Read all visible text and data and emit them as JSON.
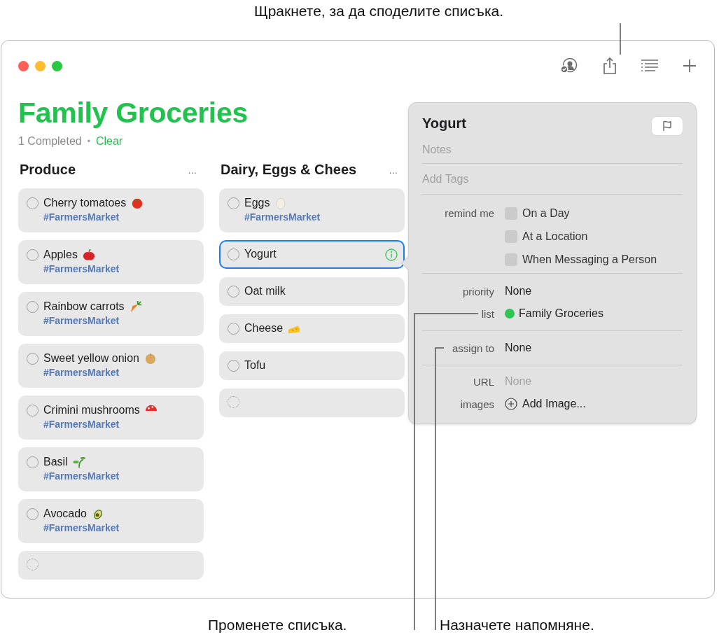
{
  "callout_share": "Щракнете, за да споделите списъка.",
  "callout_list": "Променете списъка.",
  "callout_assign": "Назначете напомняне.",
  "list": {
    "title": "Family Groceries",
    "completed": "1 Completed",
    "separator": "•",
    "clear": "Clear"
  },
  "columns": [
    {
      "title": "Produce",
      "more": "...",
      "items": [
        {
          "kind": "task",
          "name": "Cherry tomatoes",
          "tag": "#FarmersMarket",
          "selected": false
        },
        {
          "kind": "task",
          "name": "Apples",
          "tag": "#FarmersMarket",
          "selected": false
        },
        {
          "kind": "task",
          "name": "Rainbow carrots",
          "tag": "#FarmersMarket",
          "selected": false
        },
        {
          "kind": "task",
          "name": "Sweet yellow onion",
          "tag": "#FarmersMarket",
          "selected": false
        },
        {
          "kind": "task",
          "name": "Crimini mushrooms",
          "tag": "#FarmersMarket",
          "selected": false
        },
        {
          "kind": "task",
          "name": "Basil",
          "tag": "#FarmersMarket",
          "selected": false
        },
        {
          "kind": "task",
          "name": "Avocado",
          "tag": "#FarmersMarket",
          "selected": false
        },
        {
          "kind": "new"
        }
      ]
    },
    {
      "title": "Dairy, Eggs & Chees",
      "more": "...",
      "items": [
        {
          "kind": "task",
          "name": "Eggs",
          "tag": "#FarmersMarket",
          "selected": false
        },
        {
          "kind": "task",
          "name": "Yogurt",
          "selected": true
        },
        {
          "kind": "task",
          "name": "Oat milk",
          "selected": false
        },
        {
          "kind": "task",
          "name": "Cheese",
          "selected": false
        },
        {
          "kind": "task",
          "name": "Tofu",
          "selected": false
        },
        {
          "kind": "new"
        }
      ]
    }
  ],
  "inspector": {
    "title": "Yogurt",
    "flagged": false,
    "notes_placeholder": "Notes",
    "tags_placeholder": "Add Tags",
    "remind_label": "remind me",
    "remind_options": [
      {
        "label": "On a Day",
        "checked": false
      },
      {
        "label": "At a Location",
        "checked": false
      },
      {
        "label": "When Messaging a Person",
        "checked": false
      }
    ],
    "priority_label": "priority",
    "priority": "None",
    "list_label": "list",
    "list_name": "Family Groceries",
    "assign_label": "assign to",
    "assign": "None",
    "url_label": "URL",
    "url_placeholder": "None",
    "images_label": "images",
    "add_image": "Add Image..."
  }
}
